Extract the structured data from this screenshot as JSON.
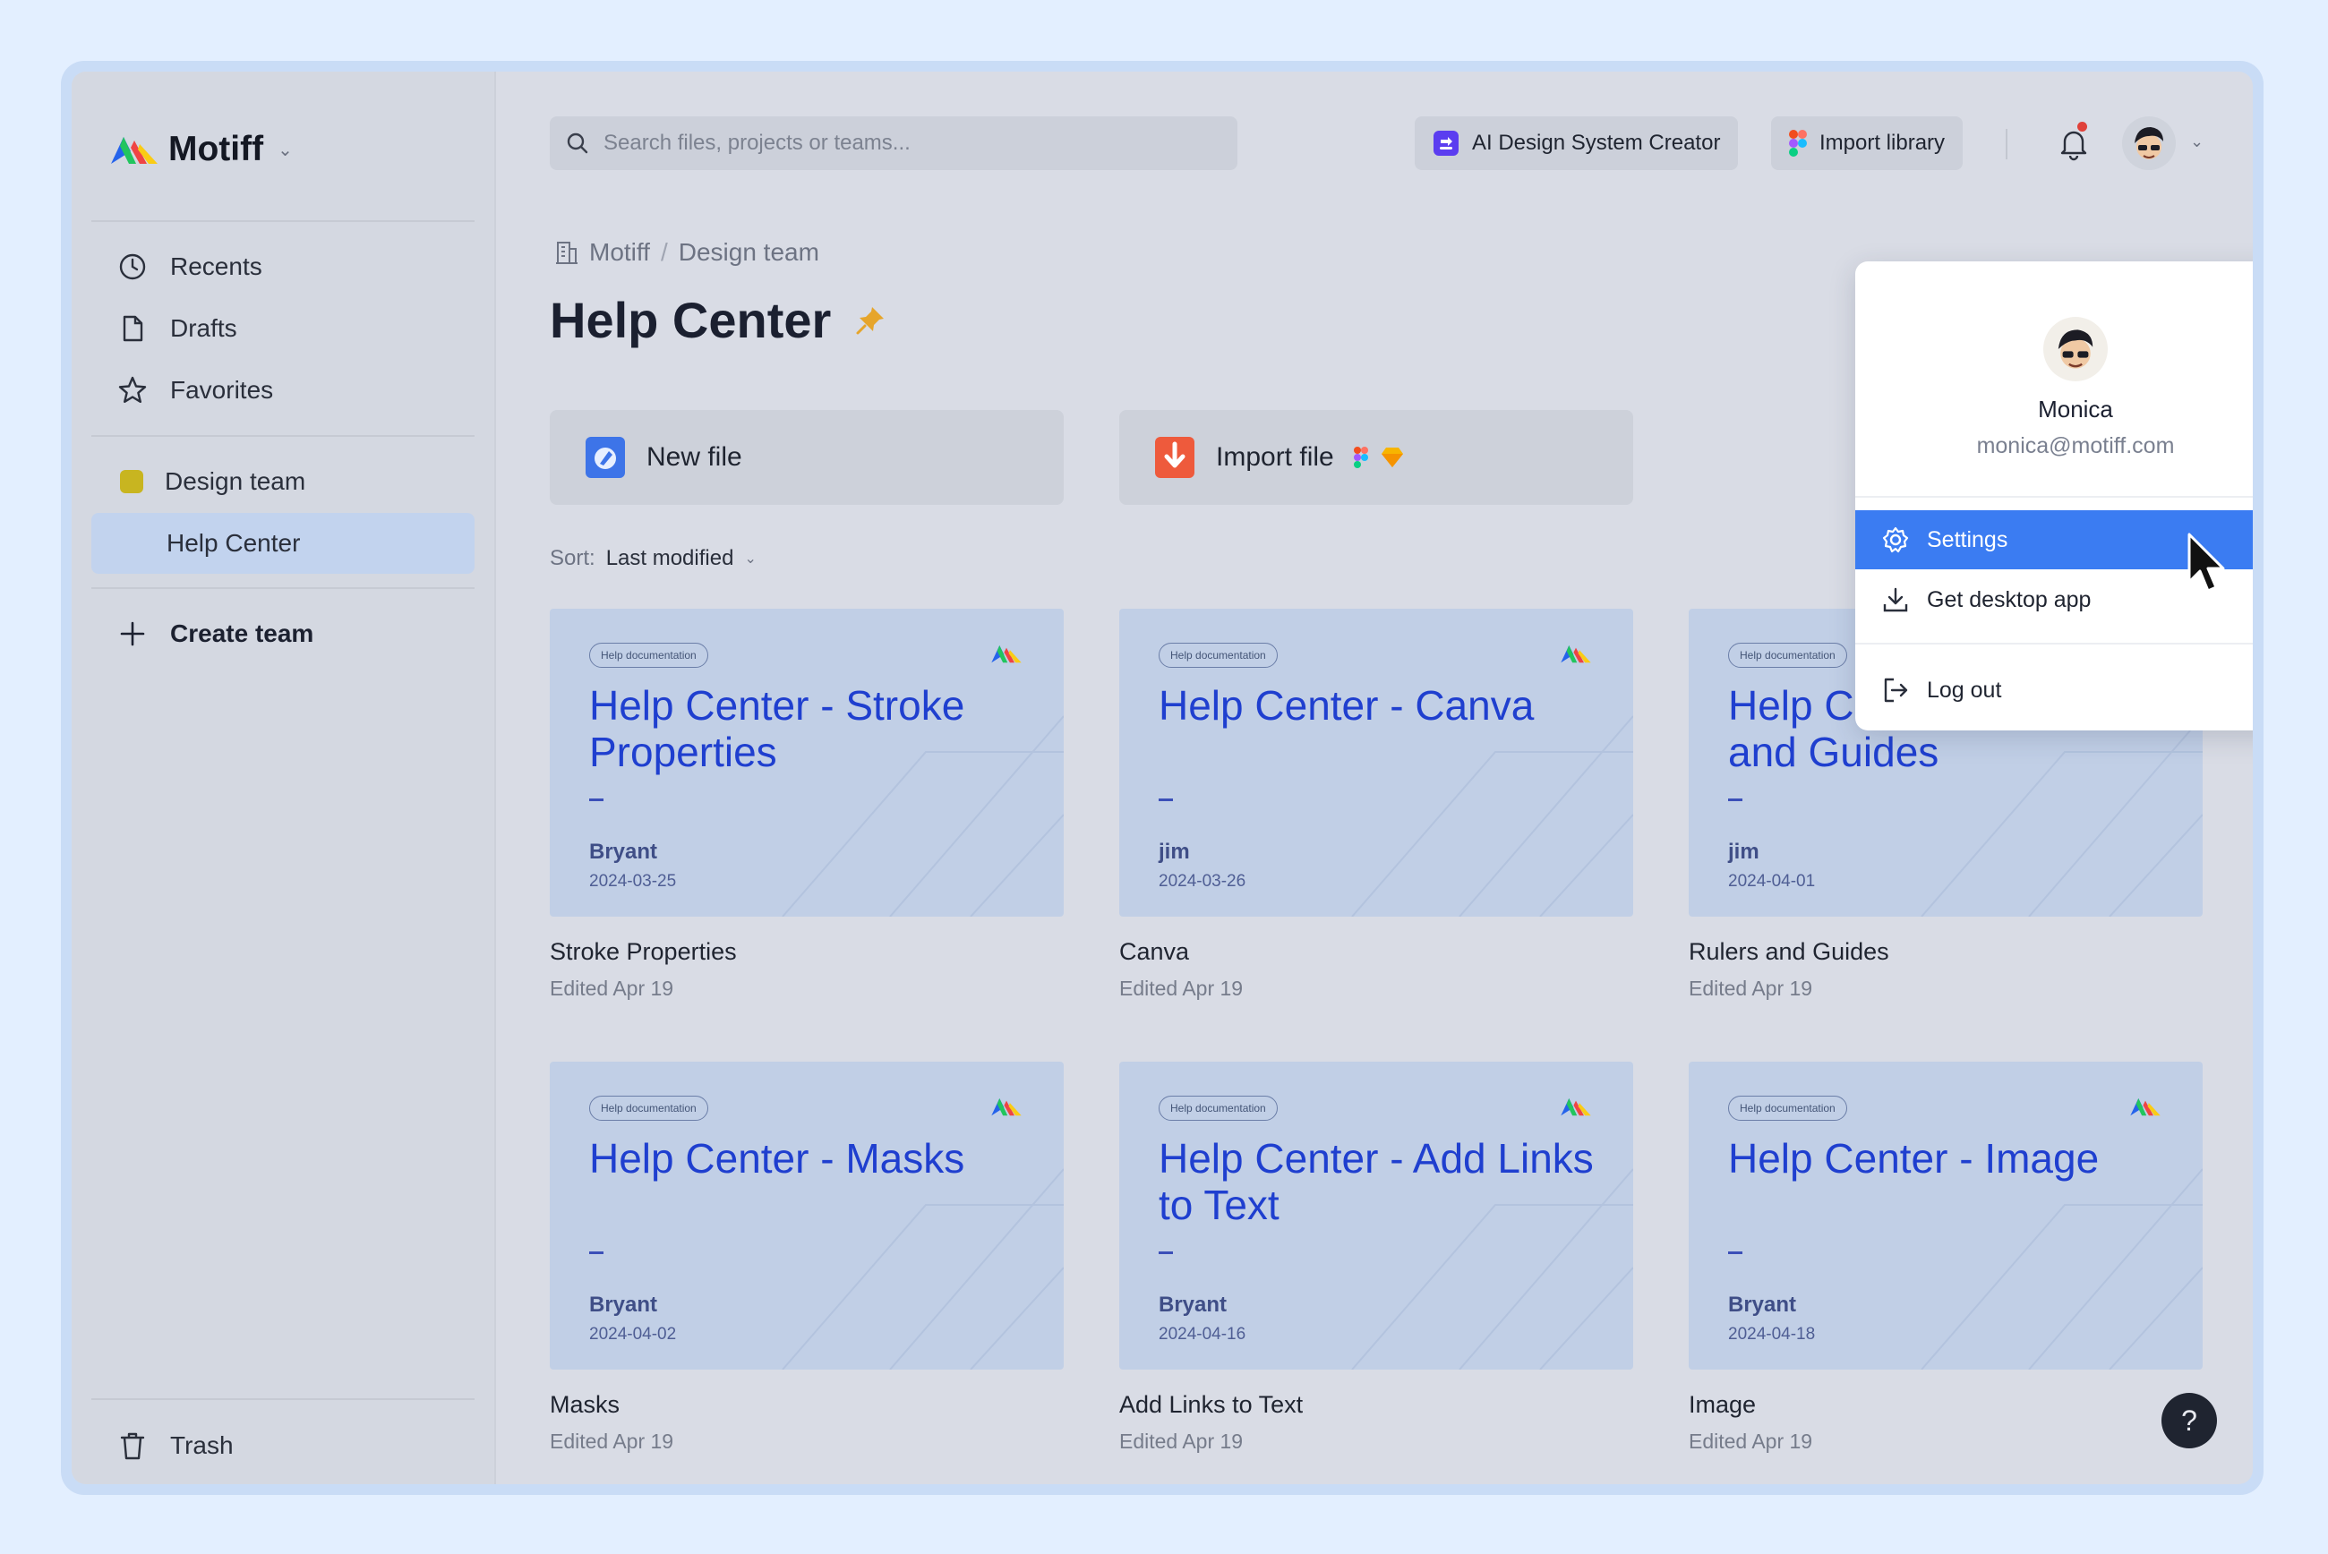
{
  "brand": {
    "name": "Motiff"
  },
  "sidebar": {
    "items": [
      {
        "label": "Recents",
        "icon": "clock-icon"
      },
      {
        "label": "Drafts",
        "icon": "file-icon"
      },
      {
        "label": "Favorites",
        "icon": "star-icon"
      }
    ],
    "team": {
      "label": "Design team",
      "color": "#c8b520"
    },
    "project": {
      "label": "Help Center"
    },
    "create_team": "Create team",
    "trash": "Trash"
  },
  "topbar": {
    "search_placeholder": "Search files, projects or teams...",
    "ai_button": "AI Design System Creator",
    "import_library": "Import library"
  },
  "breadcrumb": {
    "org": "Motiff",
    "separator": "/",
    "team": "Design team"
  },
  "page": {
    "title": "Help Center"
  },
  "actions": {
    "new_file": "New file",
    "import_file": "Import file"
  },
  "sort": {
    "label": "Sort:",
    "value": "Last modified"
  },
  "files": [
    {
      "tag": "Help documentation",
      "title": "Help Center -  Stroke Properties",
      "author": "Bryant",
      "date": "2024-03-25",
      "name": "Stroke Properties",
      "edited": "Edited Apr 19"
    },
    {
      "tag": "Help documentation",
      "title": "Help Center -  Canva",
      "author": "jim",
      "date": "2024-03-26",
      "name": "Canva",
      "edited": "Edited Apr 19"
    },
    {
      "tag": "Help documentation",
      "title": "Help Center -  Rulers and Guides",
      "author": "jim",
      "date": "2024-04-01",
      "name": "Rulers and Guides",
      "edited": "Edited Apr 19"
    },
    {
      "tag": "Help documentation",
      "title": "Help Center -  Masks",
      "author": "Bryant",
      "date": "2024-04-02",
      "name": "Masks",
      "edited": "Edited Apr 19"
    },
    {
      "tag": "Help documentation",
      "title": "Help Center -  Add Links to Text",
      "author": "Bryant",
      "date": "2024-04-16",
      "name": "Add Links to Text",
      "edited": "Edited Apr 19"
    },
    {
      "tag": "Help documentation",
      "title": "Help Center -  Image",
      "author": "Bryant",
      "date": "2024-04-18",
      "name": "Image",
      "edited": "Edited Apr 19"
    }
  ],
  "user_menu": {
    "name": "Monica",
    "email": "monica@motiff.com",
    "settings": "Settings",
    "desktop_app": "Get desktop app",
    "logout": "Log out"
  },
  "help_button": "?",
  "colors": {
    "accent": "#3b7cf2",
    "thumb_title": "#1f3fcf",
    "notification": "#e0413a"
  }
}
